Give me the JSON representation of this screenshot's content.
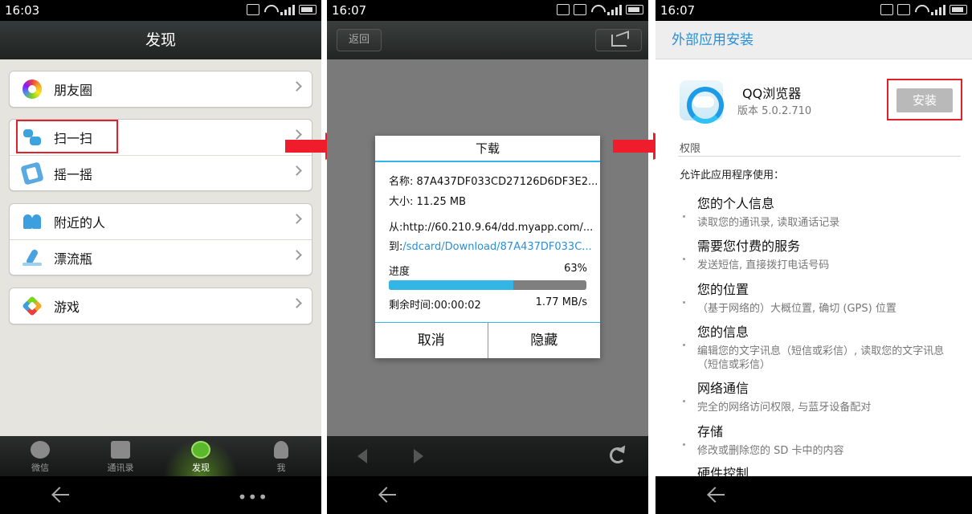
{
  "panel1": {
    "status_time": "16:03",
    "title": "发现",
    "items": [
      {
        "label": "朋友圈"
      },
      {
        "label": "扫一扫"
      },
      {
        "label": "摇一摇"
      },
      {
        "label": "附近的人"
      },
      {
        "label": "漂流瓶"
      },
      {
        "label": "游戏"
      }
    ],
    "tabs": [
      {
        "label": "微信"
      },
      {
        "label": "通讯录"
      },
      {
        "label": "发现"
      },
      {
        "label": "我"
      }
    ],
    "nav_more": "•••"
  },
  "panel2": {
    "status_time": "16:07",
    "back_label": "返回",
    "dialog": {
      "title": "下载",
      "name_line": "名称: 87A437DF033CD27126D6DF3E2...",
      "size_line": "大小: 11.25 MB",
      "from_line": "从:http://60.210.9.64/dd.myapp.com/...",
      "to_prefix": "到:",
      "to_path": "/sdcard/Download/87A437DF033C...",
      "progress_label": "进度",
      "progress_pct_text": "63%",
      "progress_fraction": 0.63,
      "remaining": "剩余时间:00:00:02",
      "speed": "1.77 MB/s",
      "cancel_label": "取消",
      "hide_label": "隐藏"
    }
  },
  "panel3": {
    "status_time": "16:07",
    "title": "外部应用安装",
    "app_name": "QQ浏览器",
    "app_version": "版本 5.0.2.710",
    "install_label": "安装",
    "permissions_label": "权限",
    "intro": "允许此应用程序使用：",
    "permissions": [
      {
        "title": "您的个人信息",
        "desc": "读取您的通讯录, 读取通话记录"
      },
      {
        "title": "需要您付费的服务",
        "desc": "发送短信, 直接拨打电话号码"
      },
      {
        "title": "您的位置",
        "desc": "（基于网络的）大概位置, 确切 (GPS) 位置"
      },
      {
        "title": "您的信息",
        "desc": "编辑您的文字讯息（短信或彩信）, 读取您的文字讯息（短信或彩信）"
      },
      {
        "title": "网络通信",
        "desc": "完全的网络访问权限, 与蓝牙设备配对"
      },
      {
        "title": "存储",
        "desc": "修改或删除您的 SD 卡中的内容"
      },
      {
        "title": "硬件控制",
        "desc": ""
      }
    ]
  },
  "colors": {
    "accent_blue": "#33b5e5",
    "highlight_red": "#e0202a",
    "arrow_red": "#ef1c2b",
    "wechat_green": "#5cb82b"
  }
}
